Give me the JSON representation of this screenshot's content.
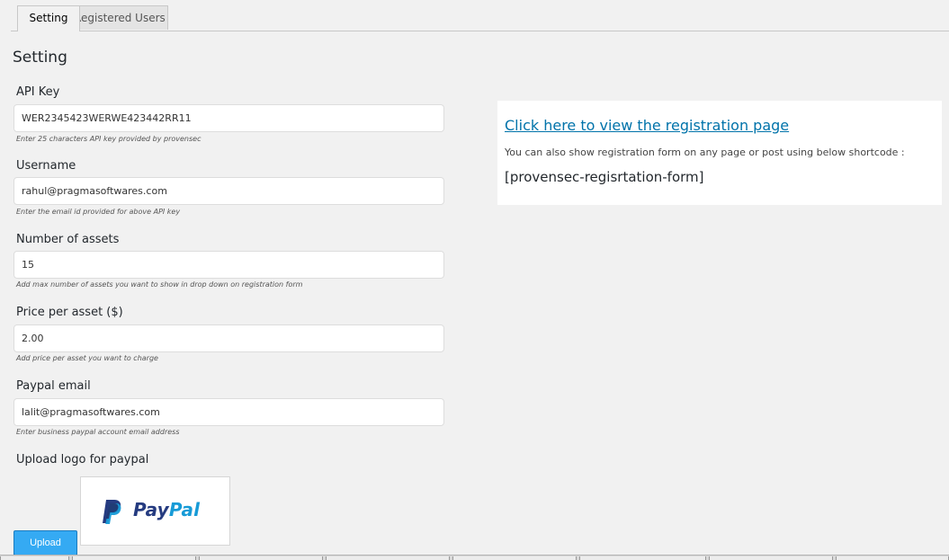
{
  "tabs": [
    {
      "label": "Setting",
      "active": true
    },
    {
      "label": "Registered Users",
      "active": false
    }
  ],
  "page_title": "Setting",
  "fields": [
    {
      "label": "API Key",
      "value": "WER2345423WERWE423442RR11",
      "hint": "Enter 25 characters API key provided by provensec"
    },
    {
      "label": "Username",
      "value": "rahul@pragmasoftwares.com",
      "hint": "Enter the email id provided for above API key"
    },
    {
      "label": "Number of assets",
      "value": "15",
      "hint": "Add max number of assets you want to show in drop down on registration form"
    },
    {
      "label": "Price per asset ($)",
      "value": "2.00",
      "hint": "Add price per asset you want to charge"
    },
    {
      "label": "Paypal email",
      "value": "lalit@pragmasoftwares.com",
      "hint": "Enter business paypal account email address"
    }
  ],
  "upload": {
    "label": "Upload logo for paypal",
    "logo_text_pay": "Pay",
    "logo_text_pal": "Pal",
    "button_label": "Upload"
  },
  "info_box": {
    "link_text": "Click here to view the registration page",
    "description": "You can also show registration form on any page or post using below shortcode :",
    "shortcode": "[provensec-regisrtation-form]"
  },
  "colors": {
    "link": "#0073aa",
    "upload_button": "#35aaf3",
    "paypal_dark": "#253b80",
    "paypal_light": "#179bd7"
  }
}
